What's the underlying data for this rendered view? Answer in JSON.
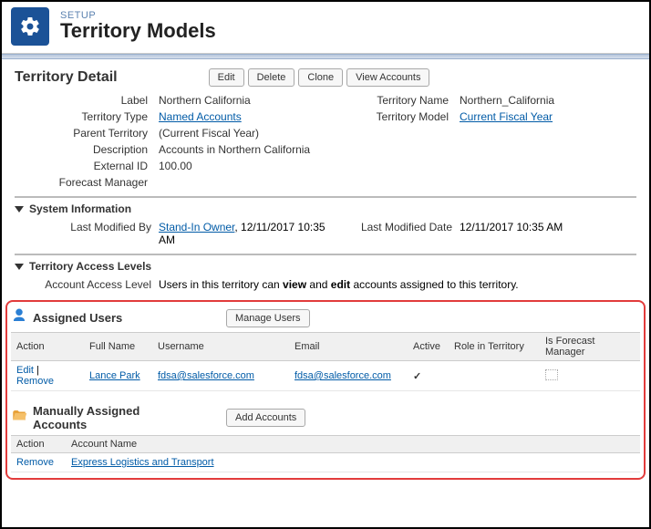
{
  "header": {
    "setup": "SETUP",
    "title": "Territory Models"
  },
  "detail": {
    "heading": "Territory Detail",
    "buttons": {
      "edit": "Edit",
      "delete": "Delete",
      "clone": "Clone",
      "viewAccounts": "View Accounts"
    },
    "labels": {
      "label": "Label",
      "territoryName": "Territory Name",
      "territoryType": "Territory Type",
      "territoryModel": "Territory Model",
      "parentTerritory": "Parent Territory",
      "description": "Description",
      "externalId": "External ID",
      "forecastManager": "Forecast Manager"
    },
    "values": {
      "label": "Northern California",
      "territoryName": "Northern_California",
      "territoryType": "Named Accounts",
      "territoryModel": "Current Fiscal Year",
      "parentTerritory": "(Current Fiscal Year)",
      "description": "Accounts in Northern California",
      "externalId": "100.00",
      "forecastManager": ""
    }
  },
  "sysInfo": {
    "heading": "System Information",
    "labels": {
      "lastModifiedBy": "Last Modified By",
      "lastModifiedDate": "Last Modified Date"
    },
    "values": {
      "lastModifiedByUser": "Stand-In Owner",
      "lastModifiedByDate": ", 12/11/2017 10:35 AM",
      "lastModifiedDate": "12/11/2017 10:35 AM"
    }
  },
  "access": {
    "heading": "Territory Access Levels",
    "labels": {
      "accountAccess": "Account Access Level"
    },
    "text": {
      "p1": "Users in this territory can ",
      "view": "view",
      "p2": " and ",
      "edit": "edit",
      "p3": " accounts assigned to this territory."
    }
  },
  "assignedUsers": {
    "heading": "Assigned Users",
    "manageBtn": "Manage Users",
    "columns": {
      "action": "Action",
      "fullName": "Full Name",
      "username": "Username",
      "email": "Email",
      "active": "Active",
      "role": "Role in Territory",
      "isFM": "Is Forecast Manager"
    },
    "row": {
      "edit": "Edit",
      "sep": " | ",
      "remove": "Remove",
      "fullName": "Lance Park",
      "username": "fdsa@salesforce.com",
      "email": "fdsa@salesforce.com"
    }
  },
  "manualAccounts": {
    "heading": "Manually Assigned Accounts",
    "addBtn": "Add Accounts",
    "columns": {
      "action": "Action",
      "accountName": "Account Name"
    },
    "row": {
      "remove": "Remove",
      "accountName": "Express Logistics and Transport"
    }
  }
}
